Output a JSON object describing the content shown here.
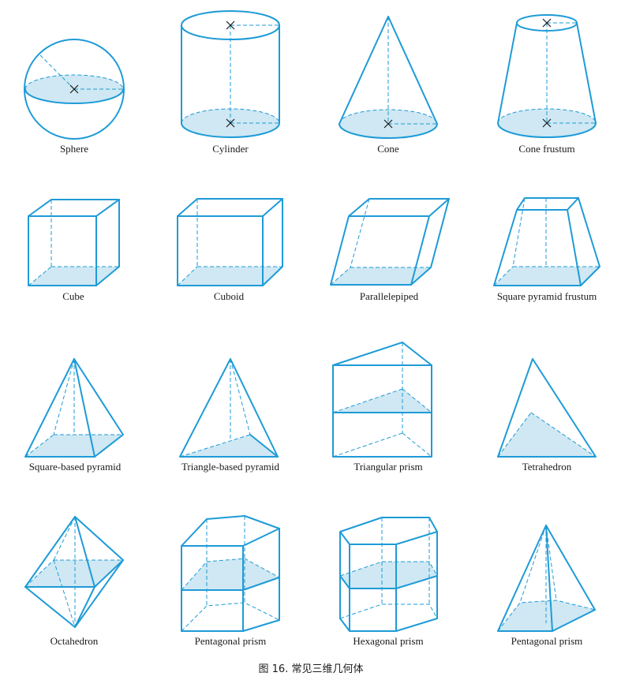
{
  "caption": "图 16. 常见三维几何体",
  "colors": {
    "edge": "#1e9bd7",
    "face": "#cfe8f3",
    "text": "#1a1a1a"
  },
  "shapes": [
    {
      "label": "Sphere"
    },
    {
      "label": "Cylinder"
    },
    {
      "label": "Cone"
    },
    {
      "label": "Cone frustum"
    },
    {
      "label": "Cube"
    },
    {
      "label": "Cuboid"
    },
    {
      "label": "Parallelepiped"
    },
    {
      "label": "Square pyramid frustum"
    },
    {
      "label": "Square-based pyramid"
    },
    {
      "label": "Triangle-based pyramid"
    },
    {
      "label": "Triangular prism"
    },
    {
      "label": "Tetrahedron"
    },
    {
      "label": "Octahedron"
    },
    {
      "label": "Pentagonal prism"
    },
    {
      "label": "Hexagonal prism"
    },
    {
      "label": "Pentagonal prism"
    }
  ]
}
